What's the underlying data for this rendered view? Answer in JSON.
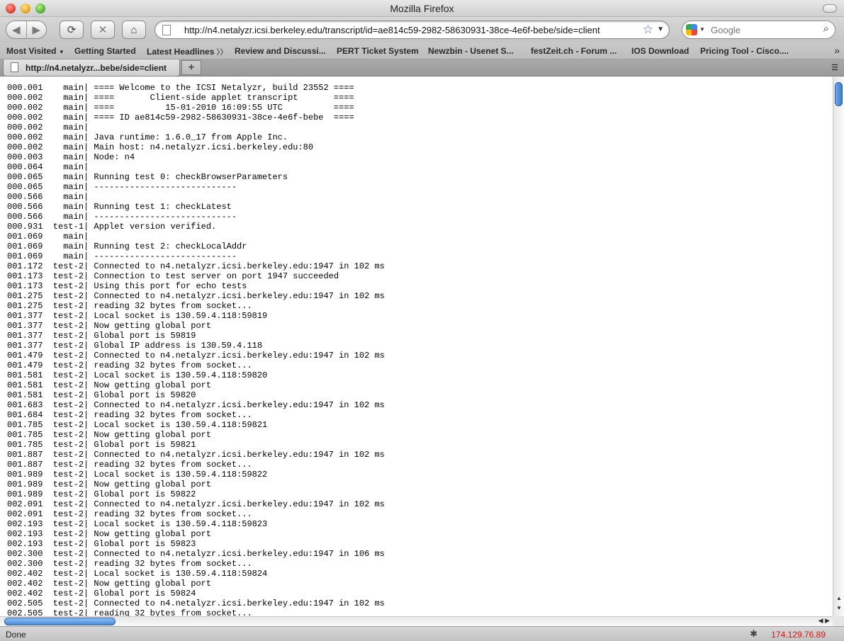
{
  "window": {
    "title": "Mozilla Firefox"
  },
  "nav": {
    "back": "◀",
    "forward": "▶",
    "reload": "⟳",
    "stop": "✕",
    "home": "⌂",
    "url": "http://n4.netalyzr.icsi.berkeley.edu/transcript/id=ae814c59-2982-58630931-38ce-4e6f-bebe/side=client",
    "search_placeholder": "Google"
  },
  "bookmarks": [
    "Most Visited",
    "Getting Started",
    "Latest Headlines",
    "Review and Discussi...",
    "PERT Ticket System",
    "Newzbin - Usenet S...",
    "festZeit.ch - Forum ...",
    "IOS Download",
    "Pricing Tool - Cisco...."
  ],
  "tab": {
    "label": "http://n4.netalyzr...bebe/side=client",
    "new_tab": "+"
  },
  "transcript": [
    "000.001    main| ==== Welcome to the ICSI Netalyzr, build 23552 ====",
    "000.002    main| ====       Client-side applet transcript       ====",
    "000.002    main| ====          15-01-2010 16:09:55 UTC          ====",
    "000.002    main| ==== ID ae814c59-2982-58630931-38ce-4e6f-bebe  ====",
    "000.002    main|",
    "000.002    main| Java runtime: 1.6.0_17 from Apple Inc.",
    "000.002    main| Main host: n4.netalyzr.icsi.berkeley.edu:80",
    "000.003    main| Node: n4",
    "000.064    main|",
    "000.065    main| Running test 0: checkBrowserParameters",
    "000.065    main| ----------------------------",
    "000.566    main|",
    "000.566    main| Running test 1: checkLatest",
    "000.566    main| ----------------------------",
    "000.931  test-1| Applet version verified.",
    "001.069    main|",
    "001.069    main| Running test 2: checkLocalAddr",
    "001.069    main| ----------------------------",
    "001.172  test-2| Connected to n4.netalyzr.icsi.berkeley.edu:1947 in 102 ms",
    "001.173  test-2| Connection to test server on port 1947 succeeded",
    "001.173  test-2| Using this port for echo tests",
    "001.275  test-2| Connected to n4.netalyzr.icsi.berkeley.edu:1947 in 102 ms",
    "001.275  test-2| reading 32 bytes from socket...",
    "001.377  test-2| Local socket is 130.59.4.118:59819",
    "001.377  test-2| Now getting global port",
    "001.377  test-2| Global port is 59819",
    "001.377  test-2| Global IP address is 130.59.4.118",
    "001.479  test-2| Connected to n4.netalyzr.icsi.berkeley.edu:1947 in 102 ms",
    "001.479  test-2| reading 32 bytes from socket...",
    "001.581  test-2| Local socket is 130.59.4.118:59820",
    "001.581  test-2| Now getting global port",
    "001.581  test-2| Global port is 59820",
    "001.683  test-2| Connected to n4.netalyzr.icsi.berkeley.edu:1947 in 102 ms",
    "001.684  test-2| reading 32 bytes from socket...",
    "001.785  test-2| Local socket is 130.59.4.118:59821",
    "001.785  test-2| Now getting global port",
    "001.785  test-2| Global port is 59821",
    "001.887  test-2| Connected to n4.netalyzr.icsi.berkeley.edu:1947 in 102 ms",
    "001.887  test-2| reading 32 bytes from socket...",
    "001.989  test-2| Local socket is 130.59.4.118:59822",
    "001.989  test-2| Now getting global port",
    "001.989  test-2| Global port is 59822",
    "002.091  test-2| Connected to n4.netalyzr.icsi.berkeley.edu:1947 in 102 ms",
    "002.091  test-2| reading 32 bytes from socket...",
    "002.193  test-2| Local socket is 130.59.4.118:59823",
    "002.193  test-2| Now getting global port",
    "002.193  test-2| Global port is 59823",
    "002.300  test-2| Connected to n4.netalyzr.icsi.berkeley.edu:1947 in 106 ms",
    "002.300  test-2| reading 32 bytes from socket...",
    "002.402  test-2| Local socket is 130.59.4.118:59824",
    "002.402  test-2| Now getting global port",
    "002.402  test-2| Global port is 59824",
    "002.505  test-2| Connected to n4.netalyzr.icsi.berkeley.edu:1947 in 102 ms",
    "002.505  test-2| reading 32 bytes from socket..."
  ],
  "status": {
    "text": "Done",
    "ip": "174.129.76.89"
  }
}
